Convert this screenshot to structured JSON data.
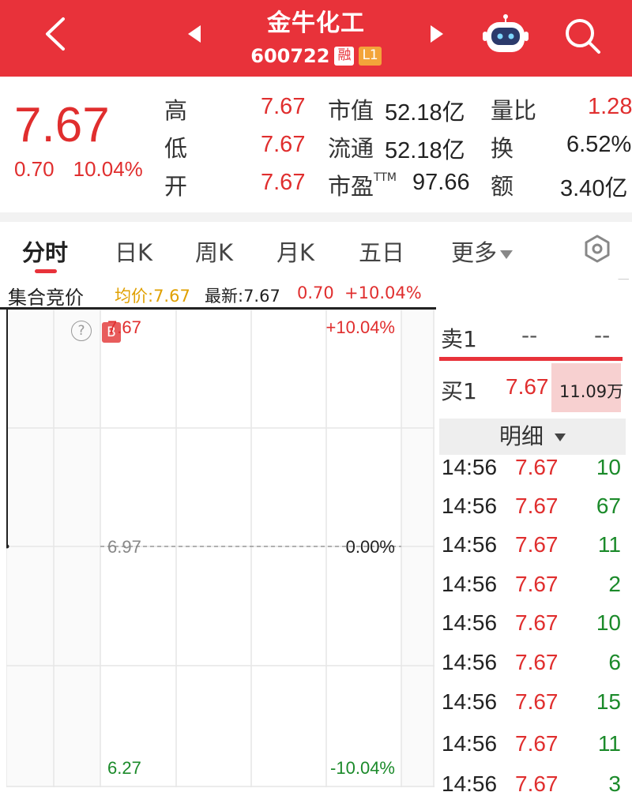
{
  "header": {
    "title": "金牛化工",
    "code": "600722",
    "badge_rong": "融",
    "badge_level": "L1"
  },
  "quote": {
    "price": "7.67",
    "change": "0.70",
    "change_pct": "10.04%",
    "stats": [
      {
        "label": "高",
        "value": "7.67"
      },
      {
        "label": "低",
        "value": "7.67"
      },
      {
        "label": "开",
        "value": "7.67"
      },
      {
        "label": "市值",
        "value": "52.18亿"
      },
      {
        "label": "流通",
        "value": "52.18亿"
      },
      {
        "label": "市盈",
        "label_sup": "TTM",
        "value": "97.66"
      },
      {
        "label": "量比",
        "value": "1.28"
      },
      {
        "label": "换",
        "value": "6.52%"
      },
      {
        "label": "额",
        "value": "3.40亿"
      }
    ]
  },
  "tabs": [
    {
      "label": "分时",
      "active": true
    },
    {
      "label": "日K"
    },
    {
      "label": "周K"
    },
    {
      "label": "月K"
    },
    {
      "label": "五日"
    },
    {
      "label": "更多"
    }
  ],
  "infobar": {
    "auction_label": "集合竞价",
    "avg_label": "均价:7.67",
    "latest_label": "最新:7.67",
    "change": "0.70",
    "change_pct": "+10.04%"
  },
  "chart_data": {
    "type": "line",
    "y_left_labels": [
      "7.67",
      "6.97",
      "6.27"
    ],
    "y_right_labels": [
      "+10.04%",
      "0.00%",
      "-10.04%"
    ],
    "ylim": [
      6.27,
      7.67
    ],
    "reference_price": 6.97,
    "marker_label": "B",
    "help_label": "?"
  },
  "orderbook": {
    "sell1": {
      "label": "卖1",
      "price": "--",
      "volume": "--"
    },
    "buy1": {
      "label": "买1",
      "price": "7.67",
      "volume": "11.09万"
    },
    "detail_label": "明细",
    "ticks": [
      {
        "time": "14:56",
        "price": "7.67",
        "volume": "10"
      },
      {
        "time": "14:56",
        "price": "7.67",
        "volume": "67"
      },
      {
        "time": "14:56",
        "price": "7.67",
        "volume": "11"
      },
      {
        "time": "14:56",
        "price": "7.67",
        "volume": "2"
      },
      {
        "time": "14:56",
        "price": "7.67",
        "volume": "10"
      },
      {
        "time": "14:56",
        "price": "7.67",
        "volume": "6"
      },
      {
        "time": "14:56",
        "price": "7.67",
        "volume": "15"
      },
      {
        "time": "14:56",
        "price": "7.67",
        "volume": "11"
      },
      {
        "time": "14:56",
        "price": "7.67",
        "volume": "3"
      }
    ]
  },
  "colors": {
    "brand_red": "#e8323a",
    "up_red": "#e02e2e",
    "down_green": "#1b8a2a",
    "avg_orange": "#e0a000"
  }
}
